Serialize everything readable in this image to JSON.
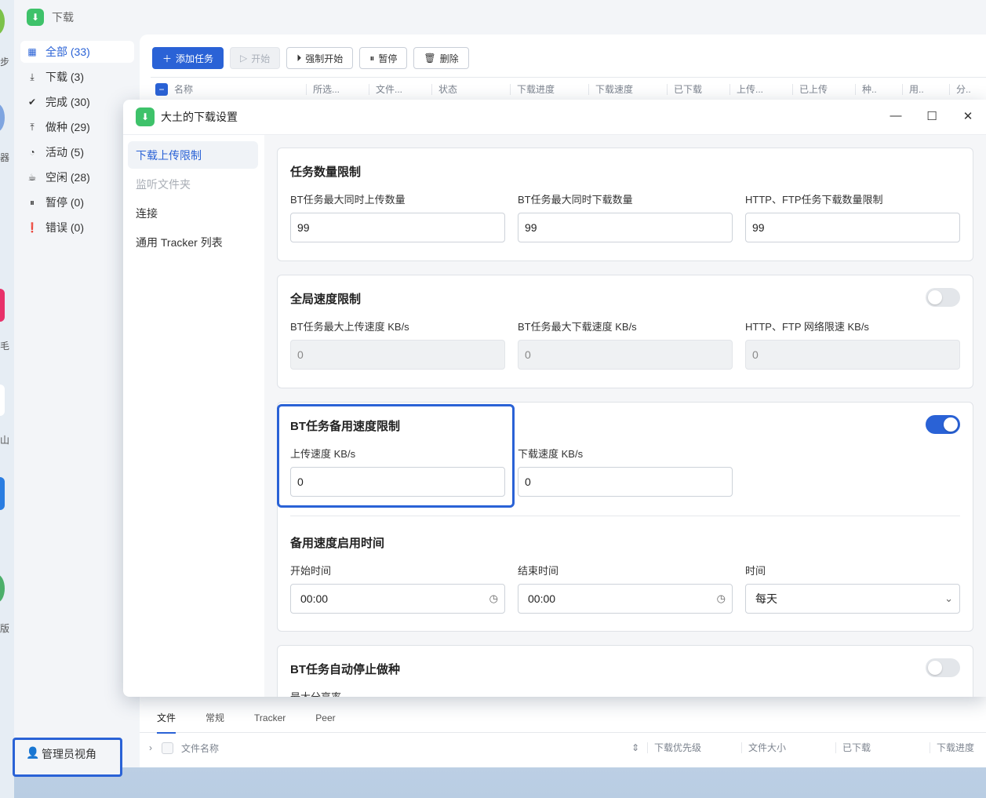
{
  "app": {
    "title": "下载"
  },
  "desktop_chars": [
    "步",
    "器",
    "毛",
    "山",
    "版"
  ],
  "sidebar": {
    "items": [
      {
        "label": "全部",
        "count": "(33)",
        "icon": "grid-icon"
      },
      {
        "label": "下载",
        "count": "(3)",
        "icon": "download-icon"
      },
      {
        "label": "完成",
        "count": "(30)",
        "icon": "check-circle-icon"
      },
      {
        "label": "做种",
        "count": "(29)",
        "icon": "upload-icon"
      },
      {
        "label": "活动",
        "count": "(5)",
        "icon": "activity-icon"
      },
      {
        "label": "空闲",
        "count": "(28)",
        "icon": "cup-icon"
      },
      {
        "label": "暂停",
        "count": "(0)",
        "icon": "pause-circle-icon"
      },
      {
        "label": "错误",
        "count": "(0)",
        "icon": "error-circle-icon"
      }
    ],
    "admin_label": "管理员视角"
  },
  "toolbar": {
    "add_label": "添加任务",
    "start_label": "开始",
    "force_start_label": "强制开始",
    "pause_label": "暂停",
    "delete_label": "删除"
  },
  "table_headers": [
    "名称",
    "所选...",
    "文件...",
    "状态",
    "下载进度",
    "下载速度",
    "已下载",
    "上传...",
    "已上传",
    "种..",
    "用..",
    "分.."
  ],
  "bottom_tabs": [
    "文件",
    "常规",
    "Tracker",
    "Peer"
  ],
  "bottom_headers": [
    "文件名称",
    "下载优先级",
    "文件大小",
    "已下载",
    "下载进度"
  ],
  "dialog": {
    "title": "大土的下载设置",
    "nav": [
      "下载上传限制",
      "监听文件夹",
      "连接",
      "通用 Tracker 列表"
    ],
    "task_limit": {
      "title": "任务数量限制",
      "bt_upload_label": "BT任务最大同时上传数量",
      "bt_upload_value": "99",
      "bt_download_label": "BT任务最大同时下载数量",
      "bt_download_value": "99",
      "http_label": "HTTP、FTP任务下载数量限制",
      "http_value": "99"
    },
    "global_speed": {
      "title": "全局速度限制",
      "enabled": false,
      "bt_upload_label": "BT任务最大上传速度 KB/s",
      "bt_upload_value": "0",
      "bt_download_label": "BT任务最大下载速度 KB/s",
      "bt_download_value": "0",
      "http_label": "HTTP、FTP 网络限速 KB/s",
      "http_value": "0"
    },
    "alt_speed": {
      "title": "BT任务备用速度限制",
      "enabled": true,
      "upload_label": "上传速度 KB/s",
      "upload_value": "0",
      "download_label": "下载速度 KB/s",
      "download_value": "0",
      "schedule_title": "备用速度启用时间",
      "start_label": "开始时间",
      "start_value": "00:00",
      "end_label": "结束时间",
      "end_value": "00:00",
      "time_label": "时间",
      "time_value": "每天"
    },
    "auto_stop": {
      "title": "BT任务自动停止做种",
      "enabled": false,
      "ratio_label": "最大分享率"
    }
  },
  "colors": {
    "accent": "#2a62d6",
    "app_green": "#3ec26a"
  }
}
